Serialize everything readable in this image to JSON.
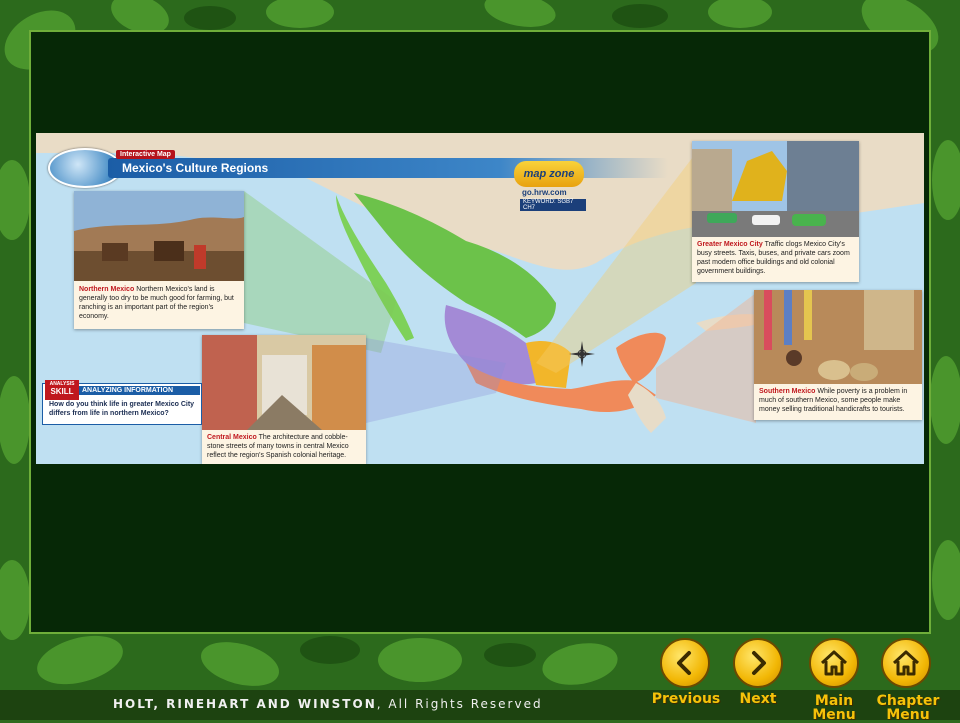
{
  "slide": {
    "map_kicker": "Interactive Map",
    "map_title": "Mexico's Culture Regions",
    "mapzone": {
      "logo": "map zone",
      "url": "go.hrw.com",
      "keyword": "KEYWORD: SGB7 CH7"
    },
    "cards": [
      {
        "heading": "Northern Mexico",
        "text": "Northern Mexico's land is generally too dry to be much good for farming, but ranching is an important part of the region's economy."
      },
      {
        "heading": "Central Mexico",
        "text": "The architecture and cobble-stone streets of many towns in central Mexico reflect the region's Spanish colonial heritage."
      },
      {
        "heading": "Greater Mexico City",
        "text": "Traffic clogs Mexico City's busy streets. Taxis, buses, and private cars zoom past modern office buildings and old colonial government buildings."
      },
      {
        "heading": "Southern Mexico",
        "text": "While poverty is a problem in much of southern Mexico, some people make money selling traditional handicrafts to tourists."
      }
    ],
    "skill": {
      "tag_top": "ANALYSIS",
      "tag_main": "SKILL",
      "label": "ANALYZING INFORMATION",
      "question": "How do you think life in greater Mexico City differs from life in northern Mexico?"
    },
    "compass": {
      "n": "N",
      "s": "S",
      "e": "E",
      "w": "W"
    }
  },
  "footer": {
    "publisher": "HOLT, RINEHART AND WINSTON",
    "rights": ", All Rights Reserved"
  },
  "nav": {
    "previous": "Previous",
    "next": "Next",
    "main_menu_1": "Main",
    "main_menu_2": "Menu",
    "chapter_menu_1": "Chapter",
    "chapter_menu_2": "Menu"
  },
  "colors": {
    "panel": "#062806",
    "button": "#f2b705",
    "label": "#f5c20a",
    "region_north": "#6cc24a",
    "region_central": "#a38ad6",
    "region_city": "#f2b62a",
    "region_south": "#f08a5a"
  }
}
